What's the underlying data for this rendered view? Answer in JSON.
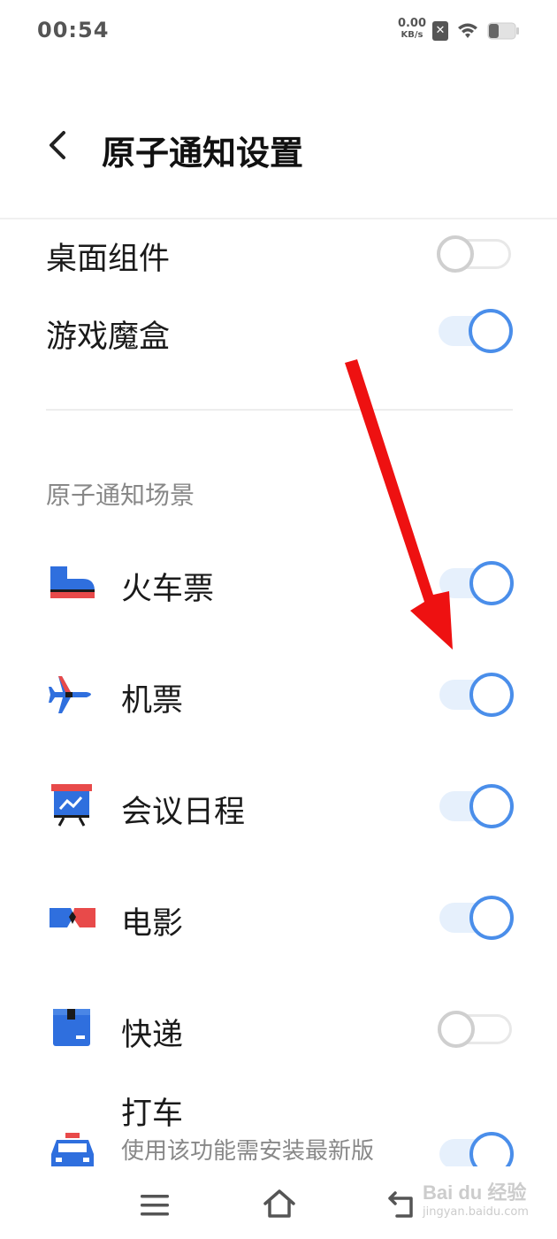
{
  "status_bar": {
    "time": "00:54",
    "net_speed_value": "0.00",
    "net_speed_unit": "KB/s",
    "sim_glyph": "✕"
  },
  "header": {
    "title": "原子通知设置",
    "back_icon": "chevron-left-icon"
  },
  "top_settings": [
    {
      "label": "桌面组件",
      "enabled": false
    },
    {
      "label": "游戏魔盒",
      "enabled": true
    }
  ],
  "section": {
    "title": "原子通知场景"
  },
  "scenes": [
    {
      "label": "火车票",
      "icon": "train-icon",
      "enabled": true
    },
    {
      "label": "机票",
      "icon": "airplane-icon",
      "enabled": true
    },
    {
      "label": "会议日程",
      "icon": "meeting-board-icon",
      "enabled": true
    },
    {
      "label": "电影",
      "icon": "movie-glasses-icon",
      "enabled": true
    },
    {
      "label": "快递",
      "icon": "package-icon",
      "enabled": false
    },
    {
      "label": "打车",
      "icon": "taxi-icon",
      "enabled": true,
      "description": "使用该功能需安装最新版本的“滴滴出行”、“高"
    }
  ],
  "watermark": {
    "logo": "Bai du 经验",
    "url": "jingyan.baidu.com"
  },
  "colors": {
    "accent": "#4a8eea",
    "track_on": "#e6f0fc",
    "icon_blue": "#2f6fde",
    "icon_red": "#e84a4a",
    "annotation_red": "#ee1111"
  }
}
